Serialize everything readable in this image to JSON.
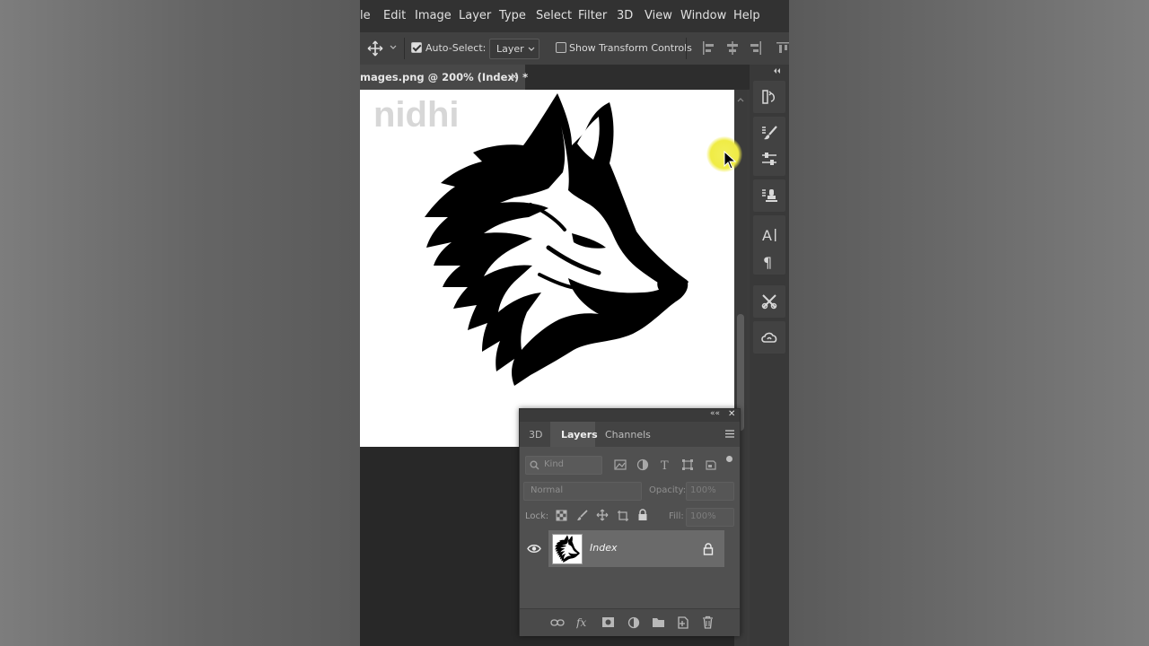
{
  "menu": [
    "le",
    "Edit",
    "Image",
    "Layer",
    "Type",
    "Select",
    "Filter",
    "3D",
    "View",
    "Window",
    "Help"
  ],
  "options_bar": {
    "move_icon": "move-icon",
    "auto_select_label": "Auto-Select:",
    "auto_select_checked": true,
    "layer_dropdown": "Layer",
    "show_transform_label": "Show Transform Controls",
    "show_transform_checked": false
  },
  "document_tab": {
    "title": "mages.png @ 200% (Index) *",
    "close": "×"
  },
  "canvas": {
    "watermark": "nidhi"
  },
  "right_tools": [
    "history-icon",
    "brush-preset-icon",
    "adjustments-icon",
    "clone-source-icon",
    "character-icon",
    "paragraph-icon",
    "tool-presets-icon",
    "creative-cloud-icon"
  ],
  "layers_panel": {
    "collapse": "««",
    "close": "✕",
    "tabs": [
      "3D",
      "Layers",
      "Channels"
    ],
    "active_tab": "Layers",
    "filter_placeholder": "Kind",
    "blend_mode": "Normal",
    "opacity_label": "Opacity:",
    "opacity_value": "100%",
    "lock_label": "Lock:",
    "fill_label": "Fill:",
    "fill_value": "100%",
    "layer": {
      "name": "Index",
      "visible": true,
      "locked": true
    }
  },
  "colors": {
    "accent_cursor": "#f0ec45",
    "panel_bg": "#505050",
    "canvas": "#ffffff"
  }
}
